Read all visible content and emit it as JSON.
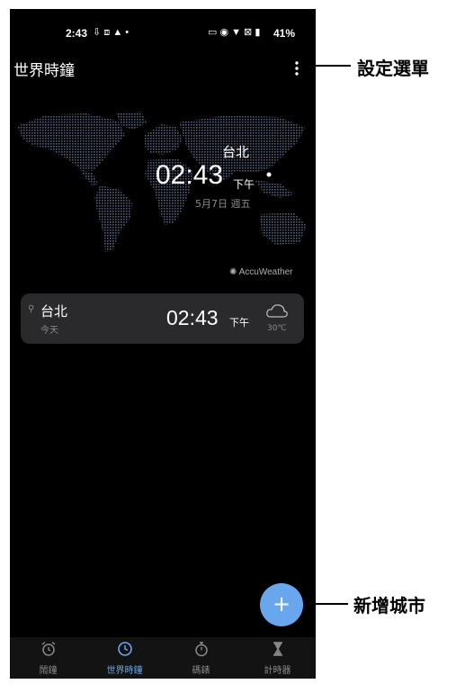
{
  "status": {
    "time": "2:43",
    "battery": "41%"
  },
  "header": {
    "title": "世界時鐘"
  },
  "map": {
    "city": "台北",
    "time": "02:43",
    "ampm": "下午",
    "date": "5月7日 週五",
    "provider": "AccuWeather"
  },
  "city_card": {
    "city": "台北",
    "day": "今天",
    "time": "02:43",
    "ampm": "下午",
    "temp": "30℃",
    "weather_icon": "cloud-icon"
  },
  "fab": {
    "label": "+"
  },
  "nav": {
    "items": [
      {
        "label": "鬧鐘",
        "icon": "alarm-icon"
      },
      {
        "label": "世界時鐘",
        "icon": "clock-icon"
      },
      {
        "label": "碼錶",
        "icon": "stopwatch-icon"
      },
      {
        "label": "計時器",
        "icon": "hourglass-icon"
      }
    ],
    "active_color": "#6aa6ee"
  },
  "callouts": {
    "settings": "設定選單",
    "add_city": "新增城市"
  }
}
